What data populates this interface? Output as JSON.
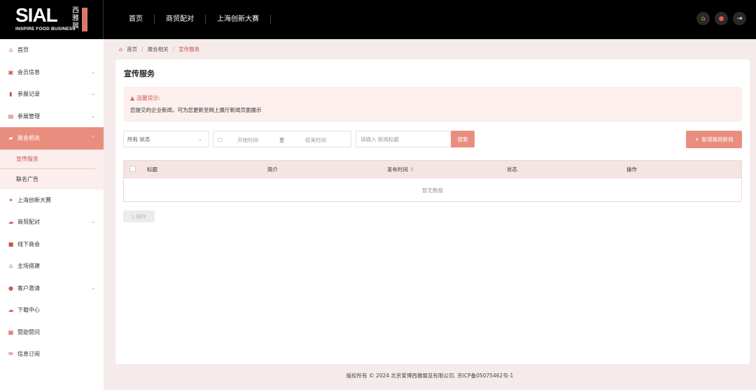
{
  "brand": {
    "logo_main": "SIAL",
    "logo_sub": "INSPIRE FOOD BUSINESS",
    "logo_cn": "西雅展"
  },
  "topnav": [
    "首页",
    "商贸配对",
    "上海创新大赛"
  ],
  "top_icons": [
    "home-icon",
    "user-icon",
    "logout-icon"
  ],
  "sidebar": {
    "items": [
      {
        "label": "首页",
        "icon": "home-icon"
      },
      {
        "label": "会员信息",
        "icon": "member-icon"
      },
      {
        "label": "参展记录",
        "icon": "bookmark-icon"
      },
      {
        "label": "参展管理",
        "icon": "document-icon"
      },
      {
        "label": "展会相关",
        "icon": "book-icon"
      },
      {
        "label": "上海创新大赛",
        "icon": "gift-icon"
      },
      {
        "label": "商贸配对",
        "icon": "chat-icon"
      },
      {
        "label": "线下商会",
        "icon": "video-icon"
      },
      {
        "label": "主场搭建",
        "icon": "building-icon"
      },
      {
        "label": "客户邀请",
        "icon": "people-icon"
      },
      {
        "label": "下载中心",
        "icon": "cloud-icon"
      },
      {
        "label": "赞助赞问",
        "icon": "sponsor-icon"
      },
      {
        "label": "信息订阅",
        "icon": "mail-icon"
      }
    ],
    "sub_items": [
      "宣传服务",
      "联名广告"
    ]
  },
  "breadcrumb": [
    "首页",
    "展会相关",
    "宣传服务"
  ],
  "page": {
    "title": "宣传服务",
    "notice_title": "温馨提示:",
    "notice_text": "您提交的企业新闻，可为您更新至网上展厅新闻页面展示"
  },
  "filters": {
    "status_value": "所有 状态",
    "date_start_placeholder": "开始时间",
    "date_to": "至",
    "date_end_placeholder": "结束时间",
    "search_placeholder": "请输入 新闻标题",
    "search_button": "搜索",
    "add_button": "新增展商新闻"
  },
  "table": {
    "columns": [
      "标题",
      "简介",
      "发布时间",
      "状态",
      "操作"
    ],
    "empty_text": "暂无数据",
    "delete_button": "删除"
  },
  "footer": "版权所有 © 2024 北京爱博西雅展览有限公司. 京ICP备05075462号-1",
  "colors": {
    "accent": "#e98e7e",
    "accent_dark": "#c9574a",
    "topbar": "#000000",
    "page_bg": "#f4ebea"
  }
}
